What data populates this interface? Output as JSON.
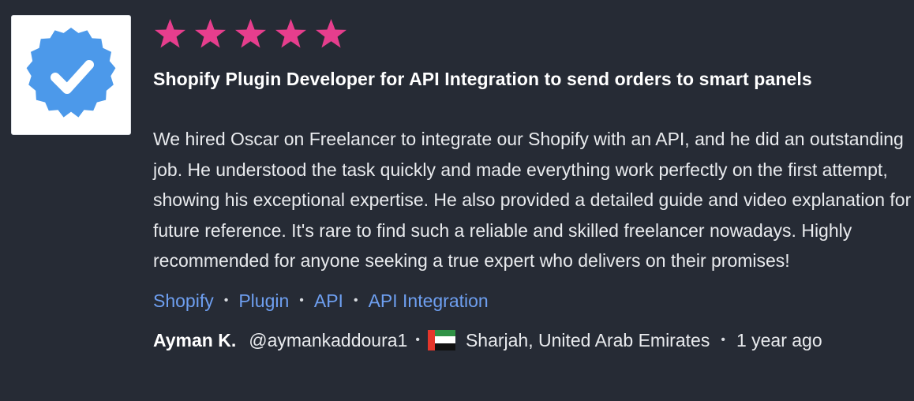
{
  "review": {
    "rating": 5,
    "star_color": "#e63e8d",
    "title": "Shopify Plugin Developer for API Integration to send orders to smart panels",
    "body": "We hired Oscar on Freelancer to integrate our Shopify with an API, and he did an outstanding job. He understood the task quickly and made everything work perfectly on the first attempt, showing his exceptional expertise. He also provided a detailed guide and video explanation for future reference. It's rare to find such a reliable and skilled freelancer nowadays. Highly recommended for anyone seeking a true expert who delivers on their promises!",
    "skills": [
      "Shopify",
      "Plugin",
      "API",
      "API Integration"
    ],
    "skill_color": "#6e9ff0",
    "reviewer": {
      "name": "Ayman K.",
      "handle": "@aymankaddoura1",
      "flag_icon": "uae-flag-icon",
      "location": "Sharjah, United Arab Emirates",
      "time_ago": "1 year ago"
    },
    "avatar_icon": "verified-badge-icon",
    "avatar_color": "#4c99ea"
  }
}
